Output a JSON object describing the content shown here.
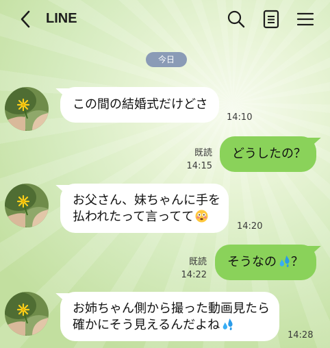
{
  "header": {
    "title": "LINE",
    "icons": [
      "back-chevron-icon",
      "search-icon",
      "note-icon",
      "menu-icon"
    ]
  },
  "date_pill": "今日",
  "messages": [
    {
      "side": "in",
      "lines": [
        "この間の結婚式だけどさ"
      ],
      "time": "14:10"
    },
    {
      "side": "out",
      "lines": [
        "どうしたの？"
      ],
      "read": "既読",
      "time": "14:15"
    },
    {
      "side": "in",
      "lines": [
        "お父さん、妹ちゃんに手を",
        "払われたって言ってて"
      ],
      "emoji": "flushed-face-emoji",
      "time": "14:20"
    },
    {
      "side": "out",
      "lines_parts": [
        "そうなの",
        "？"
      ],
      "emoji": "sweat-droplets-emoji",
      "read": "既読",
      "time": "14:22"
    },
    {
      "side": "in",
      "lines": [
        "お姉ちゃん側から撮った動画見たら",
        "確かにそう見えるんだよね"
      ],
      "emoji": "sweat-droplets-emoji",
      "time": "14:28"
    }
  ],
  "colors": {
    "outgoing_bubble": "#8ad25a",
    "incoming_bubble": "#ffffff",
    "date_pill": "#8a9bb6",
    "background": "#d5ebbe"
  }
}
